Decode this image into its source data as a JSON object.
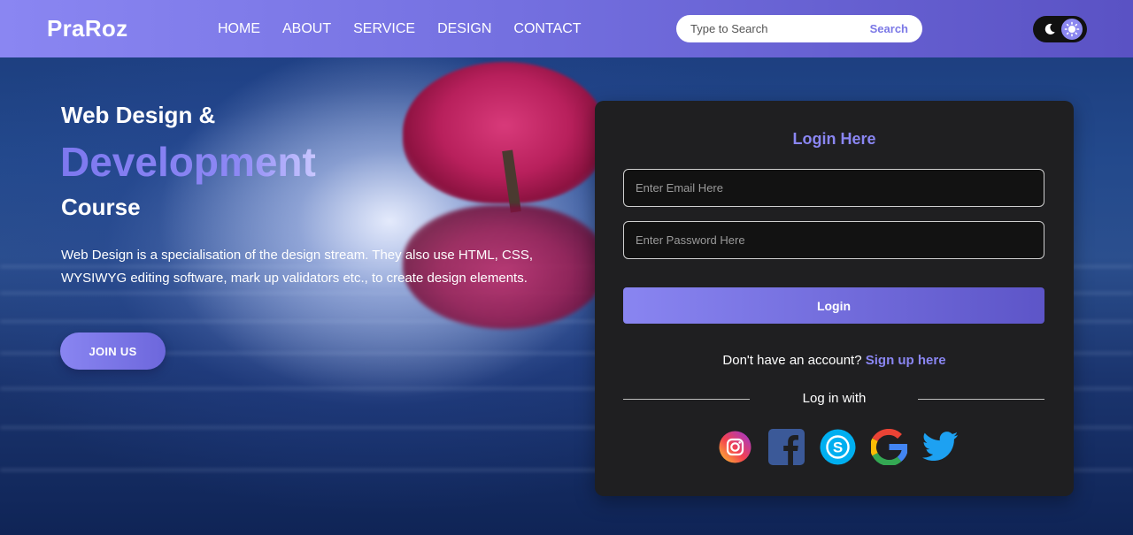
{
  "brand": {
    "logo": "PraRoz"
  },
  "nav": {
    "items": [
      "HOME",
      "ABOUT",
      "SERVICE",
      "DESIGN",
      "CONTACT"
    ]
  },
  "search": {
    "placeholder": "Type to Search",
    "button_label": "Search"
  },
  "theme_toggle": {
    "icons": [
      "moon-icon",
      "sun-icon"
    ],
    "active": "sun"
  },
  "hero": {
    "line1": "Web Design &",
    "line2": "Development",
    "line3": "Course",
    "description": "Web Design is a specialisation of the design stream. They also use HTML, CSS, WYSIWYG editing software, mark up validators etc., to create design elements.",
    "cta_label": "JOIN US"
  },
  "login": {
    "title": "Login Here",
    "email_placeholder": "Enter Email Here",
    "password_placeholder": "Enter Password Here",
    "button_label": "Login",
    "signup_prompt": "Don't have an account?",
    "signup_link": "Sign up here",
    "login_with": "Log in with",
    "socials": [
      "instagram-icon",
      "facebook-icon",
      "skype-icon",
      "google-icon",
      "twitter-icon"
    ]
  },
  "colors": {
    "accent": "#8a86f2",
    "card_bg": "#1f1f21",
    "nav_start": "#8a86f2",
    "nav_end": "#5a52c4"
  }
}
